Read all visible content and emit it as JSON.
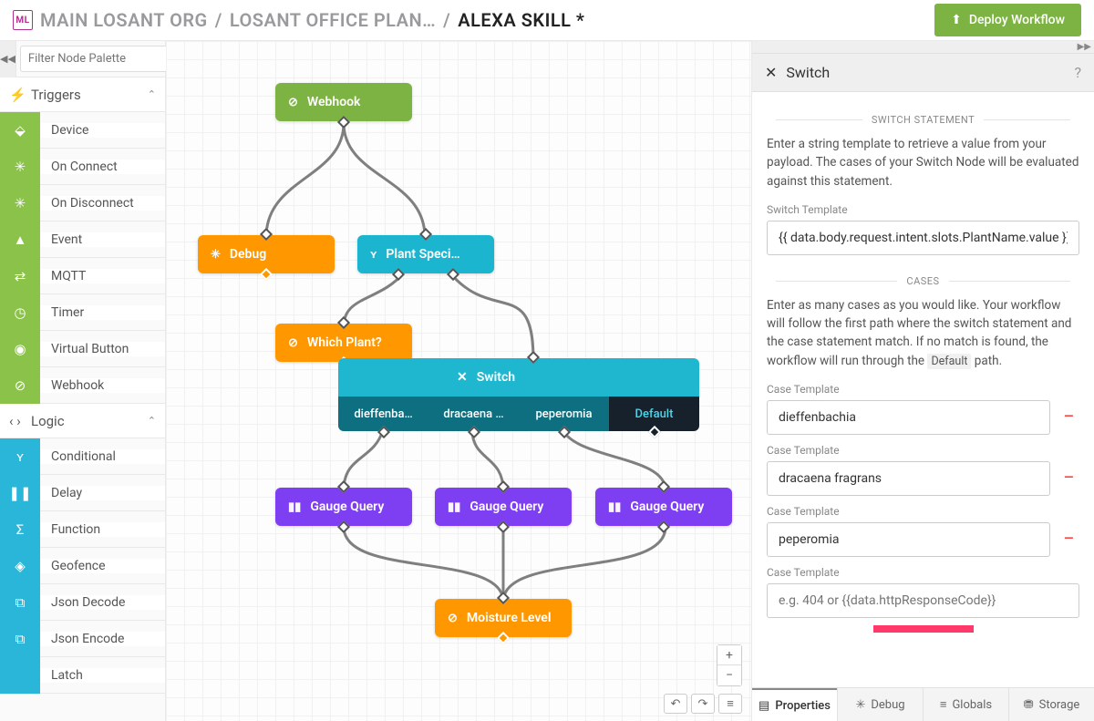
{
  "header": {
    "logo_text": "ML",
    "crumbs": [
      "MAIN LOSANT ORG",
      "LOSANT OFFICE PLAN…",
      "ALEXA SKILL *"
    ],
    "deploy_label": "Deploy Workflow"
  },
  "palette": {
    "filter_placeholder": "Filter Node Palette",
    "groups": [
      {
        "id": "triggers",
        "label": "Triggers",
        "color": "green",
        "items": [
          {
            "icon": "⬙",
            "label": "Device"
          },
          {
            "icon": "✳",
            "label": "On Connect"
          },
          {
            "icon": "✳",
            "label": "On Disconnect"
          },
          {
            "icon": "▲",
            "label": "Event"
          },
          {
            "icon": "⇄",
            "label": "MQTT"
          },
          {
            "icon": "◷",
            "label": "Timer"
          },
          {
            "icon": "◉",
            "label": "Virtual Button"
          },
          {
            "icon": "⊘",
            "label": "Webhook"
          }
        ]
      },
      {
        "id": "logic",
        "label": "Logic",
        "color": "blue",
        "items": [
          {
            "icon": "ʏ",
            "label": "Conditional"
          },
          {
            "icon": "❚❚",
            "label": "Delay"
          },
          {
            "icon": "Σ",
            "label": "Function"
          },
          {
            "icon": "◈",
            "label": "Geofence"
          },
          {
            "icon": "⧉",
            "label": "Json Decode"
          },
          {
            "icon": "⧉",
            "label": "Json Encode"
          },
          {
            "icon": "",
            "label": "Latch"
          }
        ]
      }
    ]
  },
  "canvas": {
    "nodes": {
      "webhook": {
        "label": "Webhook",
        "icon": "⊘"
      },
      "debug": {
        "label": "Debug",
        "icon": "✳"
      },
      "plantspec": {
        "label": "Plant Speci…",
        "icon": "ʏ"
      },
      "whichplant": {
        "label": "Which Plant?",
        "icon": "⊘"
      },
      "switch": {
        "label": "Switch",
        "icon": "✕"
      },
      "cases": [
        "dieffenba…",
        "dracaena …",
        "peperomia",
        "Default"
      ],
      "gq1": {
        "label": "Gauge Query",
        "icon": "▮▮"
      },
      "gq2": {
        "label": "Gauge Query",
        "icon": "▮▮"
      },
      "gq3": {
        "label": "Gauge Query",
        "icon": "▮▮"
      },
      "moist": {
        "label": "Moisture Level",
        "icon": "⊘"
      }
    }
  },
  "right": {
    "title": "Switch",
    "sect1": "SWITCH STATEMENT",
    "desc1": "Enter a string template to retrieve a value from your payload. The cases of your Switch Node will be evaluated against this statement.",
    "switch_template_label": "Switch Template",
    "switch_template_value": "{{ data.body.request.intent.slots.PlantName.value }}",
    "sect2": "CASES",
    "desc2_a": "Enter as many cases as you would like. Your workflow will follow the first path where the switch statement and the case statement match. If no match is found, the workflow will run through the ",
    "desc2_code": "Default",
    "desc2_b": " path.",
    "case_label": "Case Template",
    "cases": [
      "dieffenbachia",
      "dracaena fragrans",
      "peperomia"
    ],
    "new_case_placeholder": "e.g. 404 or {{data.httpResponseCode}}",
    "tabs": [
      "Properties",
      "Debug",
      "Globals",
      "Storage"
    ],
    "tab_icons": [
      "▤",
      "✳",
      "≡",
      "⛃"
    ]
  }
}
